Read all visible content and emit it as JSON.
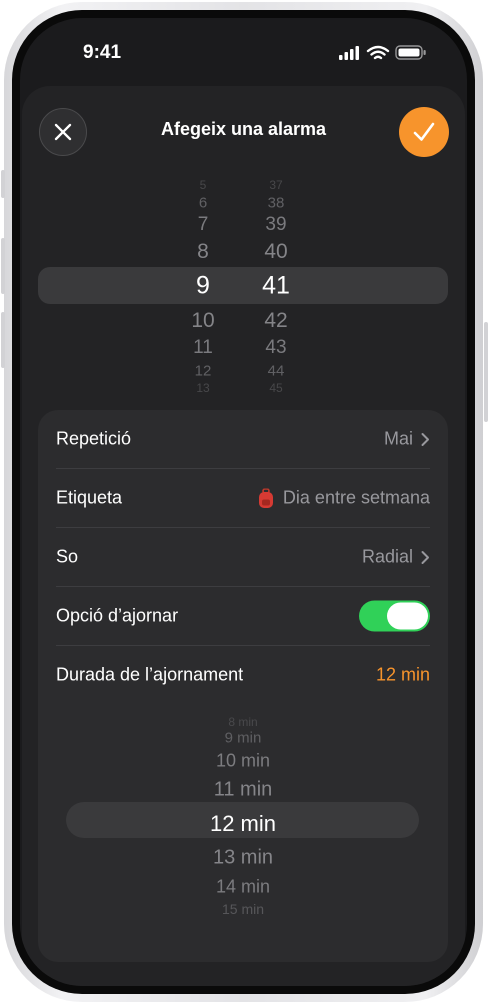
{
  "status": {
    "time": "9:41"
  },
  "header": {
    "title": "Afegeix una alarma"
  },
  "time_picker": {
    "hours": [
      "5",
      "6",
      "7",
      "8",
      "9",
      "10",
      "11",
      "12",
      "13"
    ],
    "minutes": [
      "37",
      "38",
      "39",
      "40",
      "41",
      "42",
      "43",
      "44",
      "45"
    ],
    "selected_hour": "9",
    "selected_minute": "41"
  },
  "settings": {
    "repeat": {
      "label": "Repetició",
      "value": "Mai"
    },
    "label": {
      "label": "Etiqueta",
      "value": "Dia entre setmana"
    },
    "sound": {
      "label": "So",
      "value": "Radial"
    },
    "snooze": {
      "label": "Opció d’ajornar",
      "enabled": true
    },
    "snooze_duration": {
      "label": "Durada de l’ajornament",
      "value": "12 min"
    }
  },
  "snooze_picker": {
    "options": [
      "8 min",
      "9 min",
      "10 min",
      "11 min",
      "12 min",
      "13 min",
      "14 min",
      "15 min"
    ],
    "selected": "12 min"
  },
  "colors": {
    "accent": "#f7942c",
    "toggle_on": "#30d158",
    "background": "#1b1b1d",
    "sheet": "#232325",
    "group": "#2c2c2e",
    "secondary_text": "#98989d"
  },
  "icons": {
    "close": "close-icon",
    "confirm": "checkmark-icon",
    "label": "backpack-icon",
    "chevron": "chevron-right-icon"
  }
}
